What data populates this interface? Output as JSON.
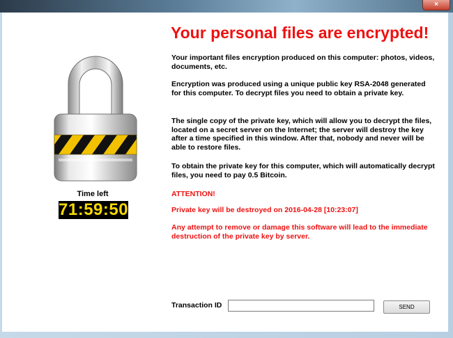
{
  "window": {
    "close_glyph": "×"
  },
  "timer": {
    "label": "Time left",
    "value": "71:59:50"
  },
  "headline": "Your personal files are encrypted!",
  "paragraphs": {
    "p1": "Your important files encryption produced on this computer: photos, videos, documents, etc.",
    "p2": "Encryption was produced using a unique public key RSA-2048 generated for this computer. To decrypt files you need to obtain a private key.",
    "p3": "The single copy of the private key, which will allow you to decrypt the files, located on a secret server on the Internet; the server will destroy the key after a time specified in this window. After that, nobody and never will be able to restore files.",
    "p4": "To obtain the private key for this computer, which will automatically decrypt files, you need to pay 0.5 Bitcoin."
  },
  "warnings": {
    "attention": "ATTENTION!",
    "destroy_date": "Private key will be destroyed on 2016-04-28 [10:23:07]",
    "tamper": "Any attempt to remove or damage this software will lead to the immediate destruction of the private key by server."
  },
  "transaction": {
    "label": "Transaction ID",
    "value": "",
    "send_label": "SEND"
  },
  "colors": {
    "alert_red": "#ee1111",
    "timer_bg": "#000000",
    "timer_text": "#f5d800"
  },
  "icons": {
    "lock": "padlock-icon"
  }
}
